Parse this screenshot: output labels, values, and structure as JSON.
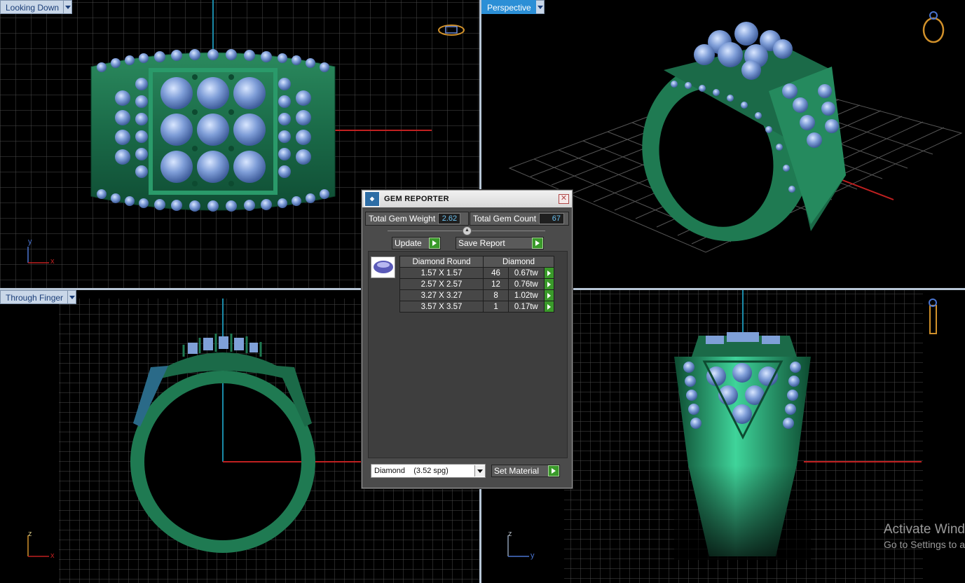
{
  "viewports": {
    "top_left": {
      "label": "Looking Down",
      "axis_a": "y",
      "axis_b": "x"
    },
    "top_right": {
      "label": "Perspective"
    },
    "bottom_left": {
      "label": "Through Finger",
      "axis_a": "z",
      "axis_b": "x"
    },
    "bottom_right": {
      "axis_a": "z",
      "axis_b": "y"
    }
  },
  "gem_reporter": {
    "title": "GEM REPORTER",
    "close_glyph": "✕",
    "total_weight_label": "Total Gem Weight",
    "total_weight_value": "2.62",
    "total_count_label": "Total Gem Count",
    "total_count_value": "67",
    "update_label": "Update",
    "save_report_label": "Save Report",
    "table": {
      "headers": [
        "Diamond Round",
        "Diamond"
      ],
      "rows": [
        {
          "size": "1.57 X 1.57",
          "count": "46",
          "weight": "0.67tw"
        },
        {
          "size": "2.57 X 2.57",
          "count": "12",
          "weight": "0.76tw"
        },
        {
          "size": "3.27 X 3.27",
          "count": "8",
          "weight": "1.02tw"
        },
        {
          "size": "3.57 X 3.57",
          "count": "1",
          "weight": "0.17tw"
        }
      ]
    },
    "material_select_value": "Diamond    (3.52 spg)",
    "set_material_label": "Set Material"
  },
  "watermark": {
    "line1": "Activate Wind",
    "line2": "Go to Settings to a"
  },
  "icons": [
    "ring-top-view-icon",
    "ring-perspective-icon",
    "ring-side-icon",
    "dropdown-arrow-icon",
    "play-icon",
    "close-icon",
    "gem-icon"
  ],
  "colors": {
    "grid": "#5a5a5a",
    "ring_green": "#1f6b4a",
    "gem_blue": "#7fa0d8",
    "axis_red": "#c02020",
    "axis_cyan": "#1a8aa8",
    "active_tab": "#2c8fd6"
  }
}
